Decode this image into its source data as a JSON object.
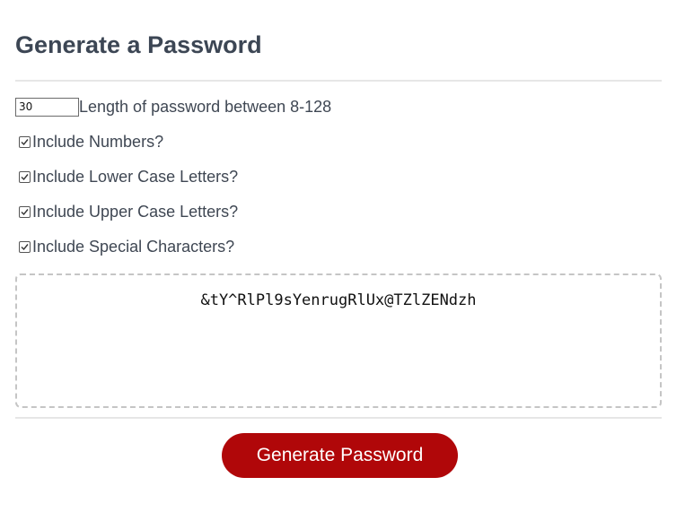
{
  "header": {
    "title": "Generate a Password"
  },
  "options": {
    "length_value": "30",
    "length_label": "Length of password between 8-128",
    "numbers_label": "Include Numbers?",
    "numbers_checked": true,
    "lowercase_label": "Include Lower Case Letters?",
    "lowercase_checked": true,
    "uppercase_label": "Include Upper Case Letters?",
    "uppercase_checked": true,
    "special_label": "Include Special Characters?",
    "special_checked": true
  },
  "result": {
    "password": "&tY^RlPl9sYenrugRlUx@TZlZENdzh"
  },
  "actions": {
    "generate_label": "Generate Password"
  },
  "colors": {
    "button_bg": "#b00709",
    "title_text": "#3c4654",
    "dashed_border": "#c5c5c5"
  },
  "icons": {
    "checkbox": "checkmark-icon"
  }
}
